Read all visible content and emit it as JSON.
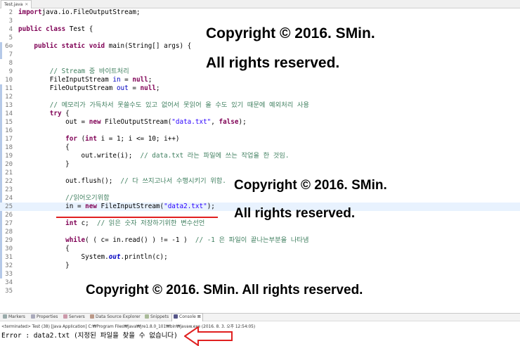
{
  "editor": {
    "tab_label": "Test.java",
    "tab_close": "✕",
    "lines": [
      {
        "n": "2",
        "parts": [
          [
            "kw",
            "import"
          ],
          [
            "",
            "java.io.FileOutputStream;"
          ]
        ]
      },
      {
        "n": "3",
        "parts": []
      },
      {
        "n": "4",
        "parts": [
          [
            "kw",
            "public class"
          ],
          [
            "",
            " Test {"
          ]
        ]
      },
      {
        "n": "5",
        "parts": []
      },
      {
        "n": "6⊖",
        "parts": [
          [
            "",
            "    "
          ],
          [
            "kw",
            "public static void"
          ],
          [
            "",
            " main(String[] args) {"
          ]
        ]
      },
      {
        "n": "7",
        "parts": []
      },
      {
        "n": "8",
        "parts": []
      },
      {
        "n": "9",
        "parts": [
          [
            "",
            "        "
          ],
          [
            "cmt",
            "// Stream 중 바이트처리"
          ]
        ]
      },
      {
        "n": "10",
        "parts": [
          [
            "",
            "        FileInputStream "
          ],
          [
            "fld",
            "in"
          ],
          [
            "",
            " = "
          ],
          [
            "kw",
            "null"
          ],
          [
            "",
            ";"
          ]
        ]
      },
      {
        "n": "11",
        "parts": [
          [
            "",
            "        FileOutputStream "
          ],
          [
            "fld",
            "out"
          ],
          [
            "",
            " = "
          ],
          [
            "kw",
            "null"
          ],
          [
            "",
            ";"
          ]
        ]
      },
      {
        "n": "12",
        "parts": []
      },
      {
        "n": "13",
        "parts": [
          [
            "",
            "        "
          ],
          [
            "cmt",
            "// 메모리가 가득차서 못쓸수도 있고 없어서 못읽어 올 수도 있기 때문에 예외처리 사용"
          ]
        ]
      },
      {
        "n": "14",
        "parts": [
          [
            "",
            "        "
          ],
          [
            "kw",
            "try"
          ],
          [
            "",
            " {"
          ]
        ]
      },
      {
        "n": "15",
        "parts": [
          [
            "",
            "            out = "
          ],
          [
            "kw",
            "new"
          ],
          [
            "",
            " FileOutputStream("
          ],
          [
            "str",
            "\"data.txt\""
          ],
          [
            "",
            ", "
          ],
          [
            "kw",
            "false"
          ],
          [
            "",
            ");"
          ]
        ]
      },
      {
        "n": "16",
        "parts": []
      },
      {
        "n": "17",
        "parts": [
          [
            "",
            "            "
          ],
          [
            "kw",
            "for"
          ],
          [
            "",
            " ("
          ],
          [
            "kw",
            "int"
          ],
          [
            "",
            " i = 1; i <= 10; i++)"
          ]
        ]
      },
      {
        "n": "18",
        "parts": [
          [
            "",
            "            {"
          ]
        ]
      },
      {
        "n": "19",
        "parts": [
          [
            "",
            "                out.write(i);  "
          ],
          [
            "cmt",
            "// data.txt 라는 파일에 쓰는 작업을 한 것임."
          ]
        ]
      },
      {
        "n": "20",
        "parts": [
          [
            "",
            "            }"
          ]
        ]
      },
      {
        "n": "21",
        "parts": []
      },
      {
        "n": "22",
        "parts": [
          [
            "",
            "            out.flush();  "
          ],
          [
            "cmt",
            "// 다 쓰지고나서 수행시키기 위함."
          ]
        ]
      },
      {
        "n": "23",
        "parts": []
      },
      {
        "n": "24",
        "parts": [
          [
            "",
            "            "
          ],
          [
            "cmt",
            "//읽어오기위함"
          ]
        ]
      },
      {
        "n": "25",
        "parts": [
          [
            "",
            "            in = "
          ],
          [
            "kw",
            "new"
          ],
          [
            "",
            " FileInputStream("
          ],
          [
            "str",
            "\"data2.txt\""
          ],
          [
            "",
            ");"
          ]
        ],
        "hl": true
      },
      {
        "n": "26",
        "parts": []
      },
      {
        "n": "27",
        "parts": [
          [
            "",
            "            "
          ],
          [
            "kw",
            "int"
          ],
          [
            "",
            " c;  "
          ],
          [
            "cmt",
            "// 읽은 숫자 저장하기위한 변수선언"
          ]
        ]
      },
      {
        "n": "28",
        "parts": []
      },
      {
        "n": "29",
        "parts": [
          [
            "",
            "            "
          ],
          [
            "kw",
            "while"
          ],
          [
            "",
            "( ( c= in.read() ) != -1 )  "
          ],
          [
            "cmt",
            "// -1 은 파일이 끝나는부분을 나타냄"
          ]
        ]
      },
      {
        "n": "30",
        "parts": [
          [
            "",
            "            {"
          ]
        ]
      },
      {
        "n": "31",
        "parts": [
          [
            "",
            "                System."
          ],
          [
            "sfld",
            "out"
          ],
          [
            "",
            ".println(c);"
          ]
        ]
      },
      {
        "n": "32",
        "parts": [
          [
            "",
            "            }"
          ]
        ]
      },
      {
        "n": "33",
        "parts": []
      },
      {
        "n": "34",
        "parts": []
      },
      {
        "n": "35",
        "parts": []
      }
    ]
  },
  "watermarks": {
    "top_line1": "Copyright © 2016. SMin.",
    "top_line2": "All rights reserved.",
    "mid_line1": "Copyright © 2016. SMin.",
    "mid_line2": "All rights reserved.",
    "bottom": "Copyright © 2016. SMin. All rights reserved."
  },
  "views": {
    "tabs": [
      "Markers",
      "Properties",
      "Servers",
      "Data Source Explorer",
      "Snippets",
      "Console ⊠"
    ],
    "terminated": "<terminated> Test (38) [Java Application] C:₩Program Files₩Java₩jre1.8.0_101₩bin₩javaw.exe (2016. 8. 3. 오후 12:54:05)",
    "error": "Error : data2.txt (지정된 파일을 찾을 수 없습니다)"
  },
  "colors": {
    "keyword": "#7f0055",
    "string": "#2a00ff",
    "comment": "#3f7f5f",
    "field": "#0000c0",
    "underline": "#e02020",
    "arrow": "#e02020"
  }
}
